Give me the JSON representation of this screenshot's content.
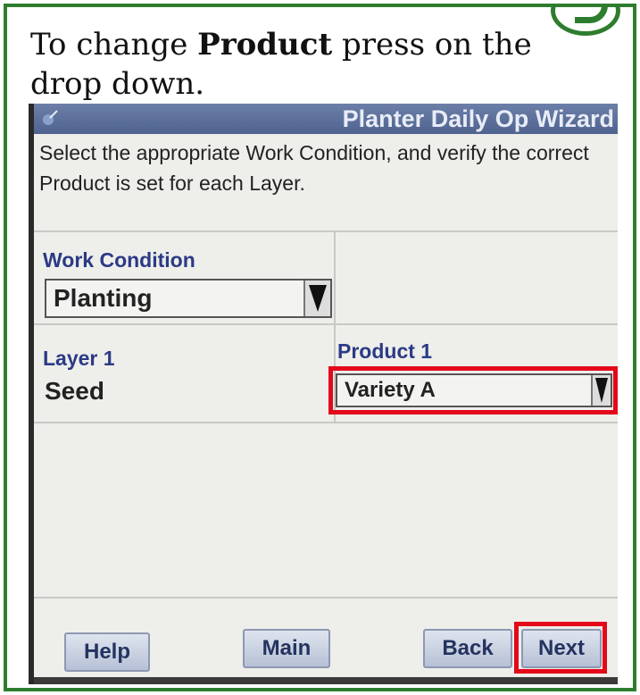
{
  "instruction": {
    "prefix": "To change ",
    "emphasis": "Product",
    "suffix": " press on the drop down."
  },
  "device": {
    "window_title": "Planter Daily Op Wizard",
    "prompt": "Select the appropriate Work Condition, and verify the correct Product is set for each Layer.",
    "work_condition": {
      "label": "Work Condition",
      "value": "Planting"
    },
    "layer": {
      "label": "Layer 1",
      "value": "Seed"
    },
    "product": {
      "label": "Product 1",
      "value": "Variety A"
    },
    "buttons": {
      "help": "Help",
      "main": "Main",
      "back": "Back",
      "next": "Next"
    }
  },
  "colors": {
    "frame_border": "#2e7d2e",
    "highlight": "#e3081a",
    "label_blue": "#2b3a86",
    "titlebar": "#5a6e99"
  },
  "icons": [
    "app-icon",
    "dropdown-arrow-icon",
    "step-badge-icon"
  ]
}
